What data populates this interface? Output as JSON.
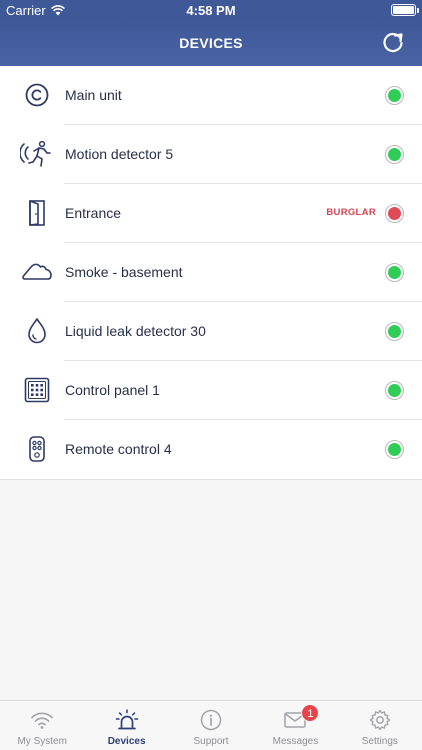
{
  "status_bar": {
    "carrier": "Carrier",
    "time": "4:58 PM"
  },
  "header": {
    "title": "DEVICES"
  },
  "colors": {
    "accent": "#3f5898",
    "ok": "#2fcc57",
    "alarm": "#e14b55"
  },
  "devices": [
    {
      "name": "Main unit",
      "icon": "copyright-circle-icon",
      "status": "ok",
      "alert": ""
    },
    {
      "name": "Motion detector 5",
      "icon": "motion-detector-icon",
      "status": "ok",
      "alert": ""
    },
    {
      "name": "Entrance",
      "icon": "door-icon",
      "status": "alarm",
      "alert": "BURGLAR"
    },
    {
      "name": "Smoke - basement",
      "icon": "cloud-icon",
      "status": "ok",
      "alert": ""
    },
    {
      "name": "Liquid leak detector 30",
      "icon": "water-drop-icon",
      "status": "ok",
      "alert": ""
    },
    {
      "name": "Control panel 1",
      "icon": "keypad-icon",
      "status": "ok",
      "alert": ""
    },
    {
      "name": "Remote control 4",
      "icon": "remote-icon",
      "status": "ok",
      "alert": ""
    }
  ],
  "tabs": [
    {
      "label": "My System",
      "icon": "wifi-icon",
      "active": false
    },
    {
      "label": "Devices",
      "icon": "siren-icon",
      "active": true
    },
    {
      "label": "Support",
      "icon": "info-icon",
      "active": false
    },
    {
      "label": "Messages",
      "icon": "envelope-icon",
      "active": false,
      "badge": "1"
    },
    {
      "label": "Settings",
      "icon": "gear-icon",
      "active": false
    }
  ]
}
